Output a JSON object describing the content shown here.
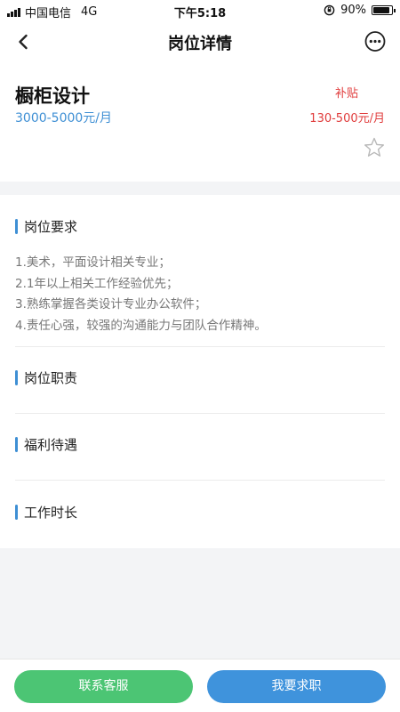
{
  "status_bar": {
    "carrier": "中国电信",
    "network": "4G",
    "time": "下午5:18",
    "battery": "90%",
    "battery_level": 0.9
  },
  "nav": {
    "title": "岗位详情",
    "back_icon": "chevron-left-icon",
    "more_icon": "more-dots-icon"
  },
  "job": {
    "title": "橱柜设计",
    "salary": "3000-5000元/月",
    "subsidy_label": "补贴",
    "subsidy_range": "130-500元/月",
    "favorite_icon": "star-outline-icon"
  },
  "sections": {
    "requirements": {
      "title": "岗位要求",
      "lines": [
        "1.美术，平面设计相关专业；",
        "2.1年以上相关工作经验优先；",
        "3.熟练掌握各类设计专业办公软件；",
        "4.责任心强，较强的沟通能力与团队合作精神。"
      ]
    },
    "duties": {
      "title": "岗位职责"
    },
    "benefits": {
      "title": "福利待遇"
    },
    "hours": {
      "title": "工作时长"
    }
  },
  "actions": {
    "contact_label": "联系客服",
    "apply_label": "我要求职"
  },
  "colors": {
    "accent_blue": "#3e8fd4",
    "subsidy_red": "#e03c3c",
    "contact_green": "#4cc574",
    "apply_blue": "#3f93dc"
  }
}
